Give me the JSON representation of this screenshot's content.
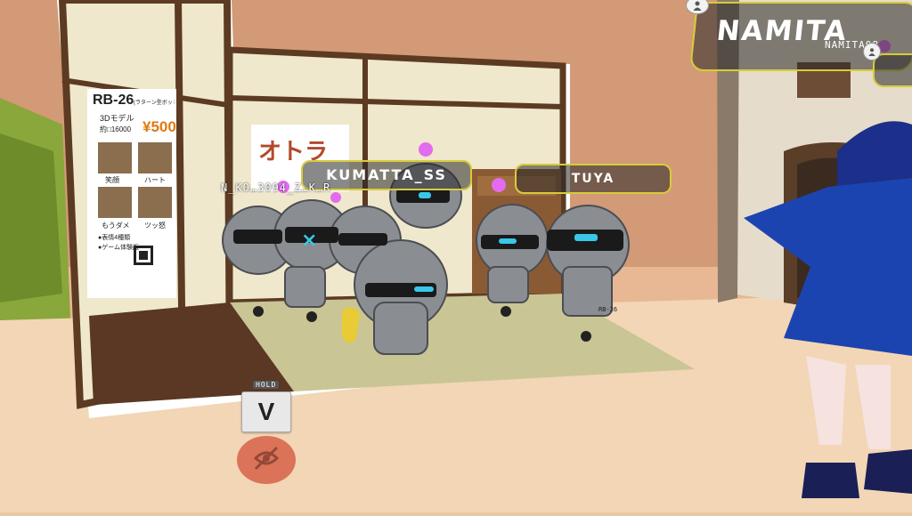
{
  "nameplates": {
    "namita": {
      "name": "NAMITA",
      "sub": "NAMITA08"
    },
    "kumatta": {
      "name": "KUMATTA_SS"
    },
    "tuya": {
      "name": "TUYA"
    },
    "niko": {
      "name": "N_KO…3094_Z…K…R"
    }
  },
  "poster": {
    "model": "RB-26",
    "model_sub": "(ラターン型ボットクローン)",
    "line1": "3Dモデル",
    "price_label": "約□16000",
    "price": "¥500",
    "cap1": "笑顔",
    "cap2": "ハート",
    "cap3": "もうダメ",
    "cap4": "ツッ怒",
    "bullet1": "●表情4種類",
    "bullet2": "●ゲーム体験版"
  },
  "wall_poster": {
    "title": "オトラ"
  },
  "robot_label": "RB-26",
  "controls": {
    "hold_label": "HOLD",
    "v_key": "V",
    "mute_icon": "mic-muted-icon"
  },
  "colors": {
    "nameplate_border": "#d8cc3a",
    "robot_body": "#8a8d92",
    "robot_accent": "#39c7e8",
    "antenna_ball": "#e36bf0",
    "avatar_blue": "#1c44b0",
    "mute_button": "#d9694e"
  }
}
